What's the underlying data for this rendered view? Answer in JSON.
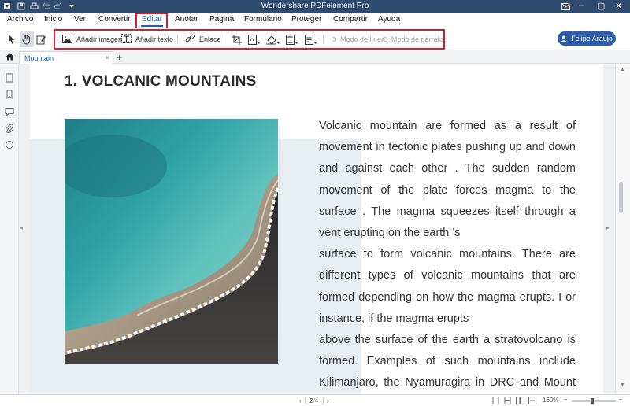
{
  "window": {
    "title": "Wondershare PDFelement Pro"
  },
  "menu": {
    "items": [
      "Archivo",
      "Inicio",
      "Ver",
      "Convertir",
      "Editar",
      "Anotar",
      "Página",
      "Formulario",
      "Proteger",
      "Compartir",
      "Ayuda"
    ],
    "active": "Editar"
  },
  "toolbar": {
    "add_image": "Añadir imagen",
    "add_text": "Añadir texto",
    "link": "Enlace",
    "line_mode": "Modo de línea",
    "paragraph_mode": "Modo de párrafo",
    "user": "Felipe Araujo"
  },
  "tabs": {
    "doc_tab": "Mountain",
    "close_glyph": "×",
    "add_glyph": "+"
  },
  "document": {
    "heading": "1. VOLCANIC MOUNTAINS",
    "paragraphs": [
      "Volcanic mountain are formed as a result of movement in tectonic plates pushing up and down and against  each other . The sudden  random movement  of the plate forces magma  to the surface . The magma squeezes itself through a vent erupting on the earth ’s",
      "surface to form volcanic mountains. There are different types of volcanic mountains that are formed depending  on how the magma erupts. For instance, if the magma erupts",
      "above the surface of the earth a stratovolcano is formed. Examples of such mountains include Kilimanjaro, the Nyamuragira in DRC and Mount"
    ]
  },
  "statusbar": {
    "page_current": "2",
    "page_total": "/4",
    "zoom": "160%"
  },
  "colors": {
    "titlebar": "#2f4b6e",
    "accent": "#1f5fbf",
    "highlight_box": "#d81e2c",
    "user_button": "#2d5fa8"
  },
  "icons": {
    "app": "app-logo-icon",
    "save": "save-icon",
    "print": "print-icon",
    "undo": "undo-icon",
    "redo": "redo-icon",
    "dropdown": "chevron-down-icon",
    "mail": "mail-icon",
    "select": "select-arrow-icon",
    "hand": "hand-icon",
    "edit": "edit-icon",
    "image": "image-icon",
    "text": "text-box-icon",
    "link": "link-icon",
    "crop": "crop-icon",
    "watermark": "watermark-icon",
    "background": "background-fill-icon",
    "header": "header-footer-icon",
    "bates": "bates-number-icon",
    "home": "home-icon",
    "thumbnails": "page-thumbnail-icon",
    "bookmark": "bookmark-icon",
    "comment": "comment-icon",
    "attachment": "attachment-icon",
    "search": "search-icon"
  }
}
